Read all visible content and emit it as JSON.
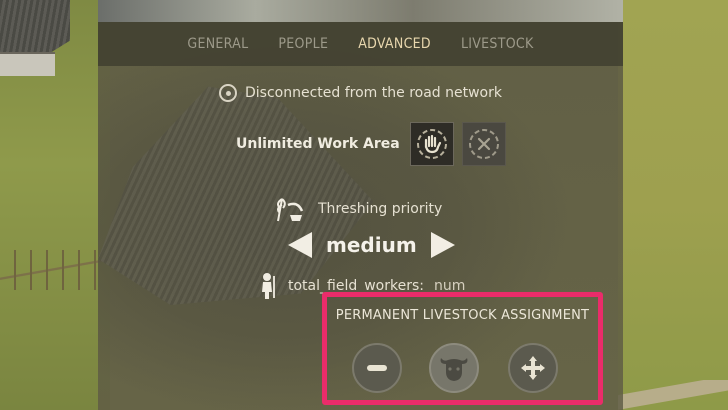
{
  "tabs": [
    {
      "label": "GENERAL",
      "active": false
    },
    {
      "label": "PEOPLE",
      "active": false
    },
    {
      "label": "ADVANCED",
      "active": true
    },
    {
      "label": "LIVESTOCK",
      "active": false
    }
  ],
  "road_status": {
    "text": "Disconnected from the road network",
    "icon": "target-icon"
  },
  "work_area": {
    "label": "Unlimited Work Area",
    "buttons": [
      {
        "icon": "hand-icon",
        "state": "selected"
      },
      {
        "icon": "close-icon",
        "state": "disabled"
      }
    ]
  },
  "threshing": {
    "label": "Threshing priority",
    "icon": "threshing-icon"
  },
  "priority": {
    "value": "medium"
  },
  "workers": {
    "label": "total_field_workers:",
    "value": "num",
    "icon": "worker-icon"
  },
  "livestock": {
    "title": "PERMANENT LIVESTOCK ASSIGNMENT",
    "buttons": [
      "minus-icon",
      "cow-icon",
      "move-icon"
    ],
    "highlight_color": "#ea2c6a"
  },
  "colors": {
    "active_tab": "#e8d7ae",
    "inactive_tab": "#9d9a8a"
  }
}
